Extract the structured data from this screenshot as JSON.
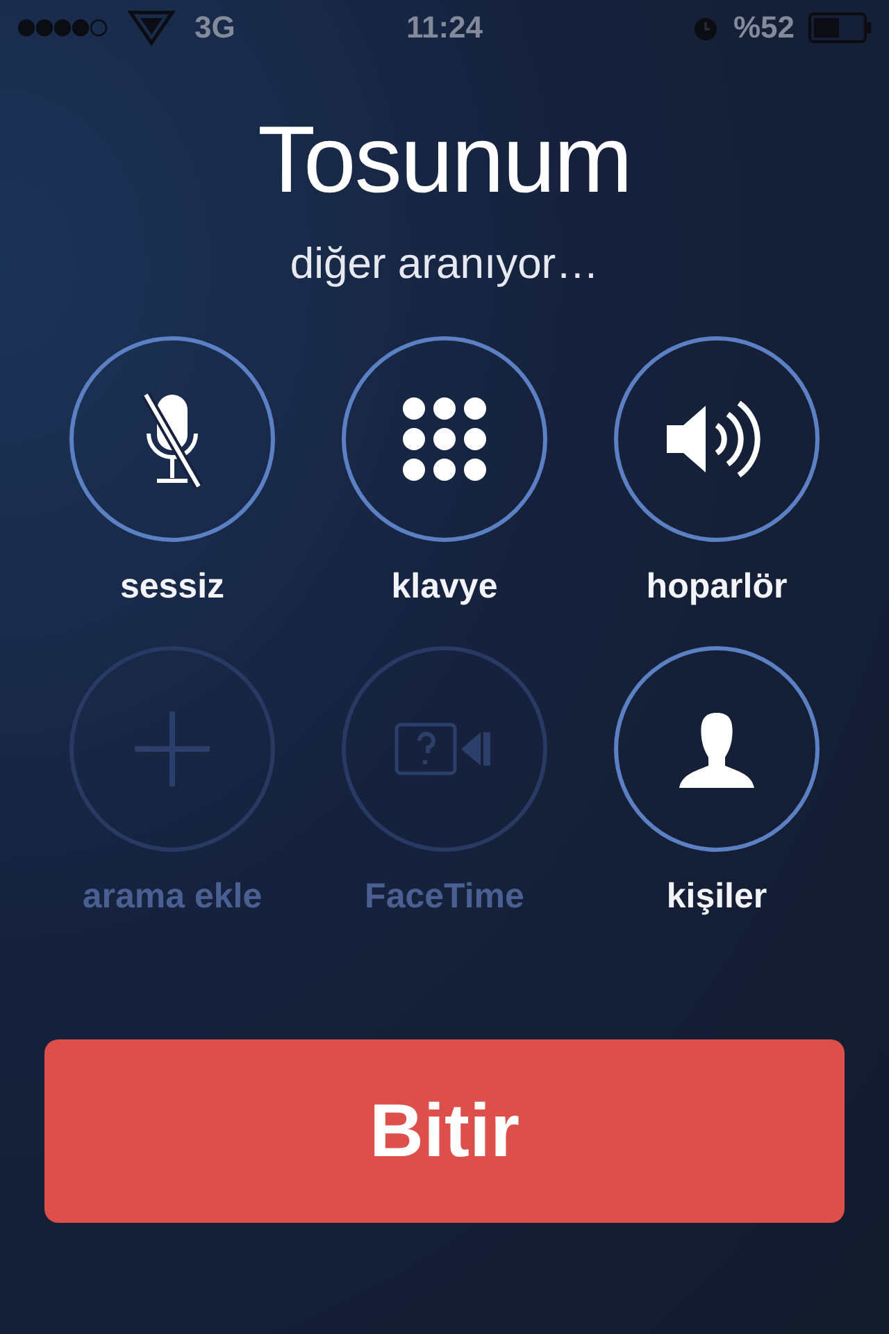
{
  "status_bar": {
    "network": "3G",
    "time": "11:24",
    "battery": "%52"
  },
  "caller": {
    "name": "Tosunum",
    "status": "diğer aranıyor…"
  },
  "buttons": [
    {
      "kind": "mute",
      "label": "sessiz",
      "disabled": false
    },
    {
      "kind": "keypad",
      "label": "klavye",
      "disabled": false
    },
    {
      "kind": "speaker",
      "label": "hoparlör",
      "disabled": false
    },
    {
      "kind": "add",
      "label": "arama ekle",
      "disabled": true
    },
    {
      "kind": "facetime",
      "label": "FaceTime",
      "disabled": true
    },
    {
      "kind": "contacts",
      "label": "kişiler",
      "disabled": false
    }
  ],
  "end_button": "Bitir"
}
